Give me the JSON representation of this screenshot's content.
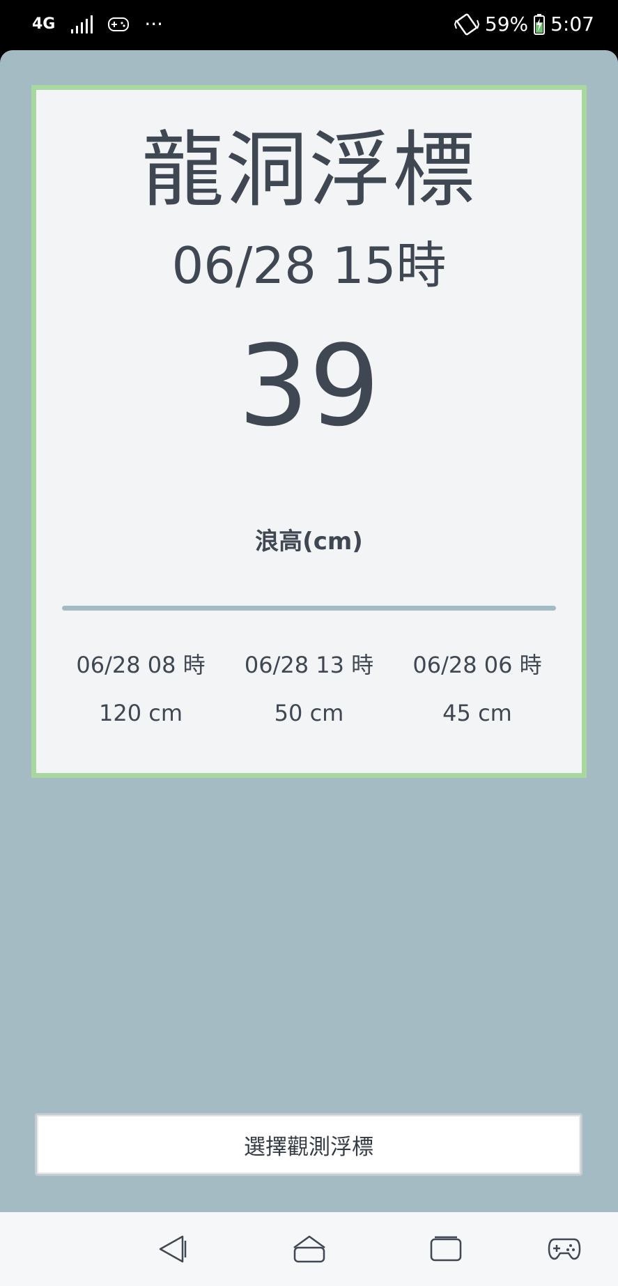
{
  "status_bar": {
    "network": "4G",
    "more": "···",
    "battery_percent": "59%",
    "time": "5:07"
  },
  "buoy": {
    "name": "龍洞浮標",
    "datetime": "06/28 15時",
    "wave_height": "39",
    "unit_label": "浪高(cm)"
  },
  "history": [
    {
      "time": "06/28 08 時",
      "value": "120 cm"
    },
    {
      "time": "06/28 13 時",
      "value": "50 cm"
    },
    {
      "time": "06/28 06 時",
      "value": "45 cm"
    }
  ],
  "select_button": {
    "label": "選擇觀測浮標"
  },
  "colors": {
    "app_background": "#a5bbc4",
    "card_border": "#a8d8a0",
    "card_background": "#f2f4f6",
    "text": "#3f4752"
  }
}
